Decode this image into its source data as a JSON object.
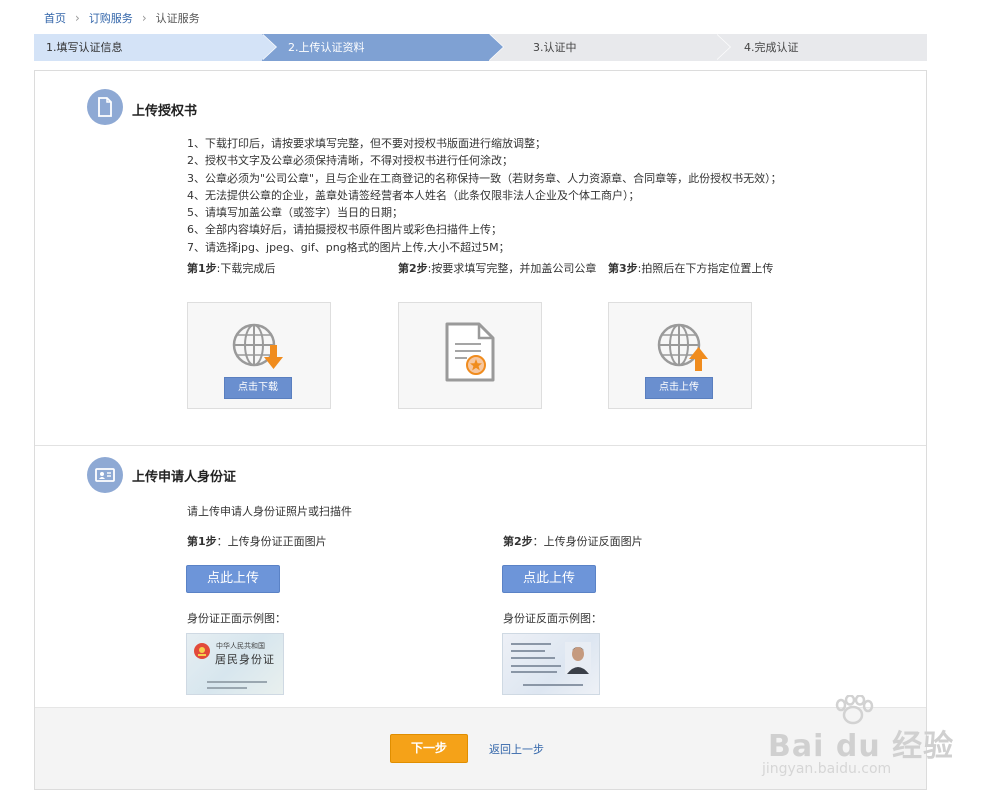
{
  "breadcrumb": {
    "home": "首页",
    "service": "订购服务",
    "current": "认证服务"
  },
  "steps": [
    "1.填写认证信息",
    "2.上传认证资料",
    "3.认证中",
    "4.完成认证"
  ],
  "auth_section": {
    "title": "上传授权书",
    "rules": [
      "1、下载打印后，请按要求填写完整，但不要对授权书版面进行缩放调整；",
      "2、授权书文字及公章必须保持清晰，不得对授权书进行任何涂改；",
      "3、公章必须为\"公司公章\"，且与企业在工商登记的名称保持一致（若财务章、人力资源章、合同章等，此份授权书无效）；",
      "4、无法提供公章的企业，盖章处请签经营者本人姓名（此条仅限非法人企业及个体工商户）；",
      "5、请填写加盖公章（或签字）当日的日期；",
      "6、全部内容填好后，请拍摄授权书原件图片或彩色扫描件上传；",
      "7、请选择jpg、jpeg、gif、png格式的图片上传,大小不超过5M；"
    ],
    "step1": {
      "prefix": "第1步",
      "text": ":下载完成后"
    },
    "step2": {
      "prefix": "第2步",
      "text": ":按要求填写完整，并加盖公司公章"
    },
    "step3": {
      "prefix": "第3步",
      "text": ":拍照后在下方指定位置上传"
    },
    "download_button": "点击下载",
    "upload_button": "点击上传",
    "icons": [
      "globe-download-icon",
      "document-seal-icon",
      "globe-upload-icon"
    ]
  },
  "id_section": {
    "title": "上传申请人身份证",
    "intro": "请上传申请人身份证照片或扫描件",
    "step1": {
      "prefix": "第1步",
      "text": "：上传身份证正面图片"
    },
    "step2": {
      "prefix": "第2步",
      "text": "：上传身份证反面图片"
    },
    "upload_label": "点此上传",
    "front_sample_label": "身份证正面示例图：",
    "back_sample_label": "身份证反面示例图：",
    "front_card": {
      "line1": "中华人民共和国",
      "line2": "居民身份证"
    }
  },
  "footer": {
    "next_button": "下一步",
    "back_link": "返回上一步"
  },
  "watermark": {
    "brand": "Bai du 经验",
    "url": "jingyan.baidu.com"
  },
  "colors": {
    "accent_blue": "#6d95d9",
    "active_step": "#7fa1d3",
    "next_orange": "#f5a218",
    "arrow_orange": "#f08c1e"
  }
}
